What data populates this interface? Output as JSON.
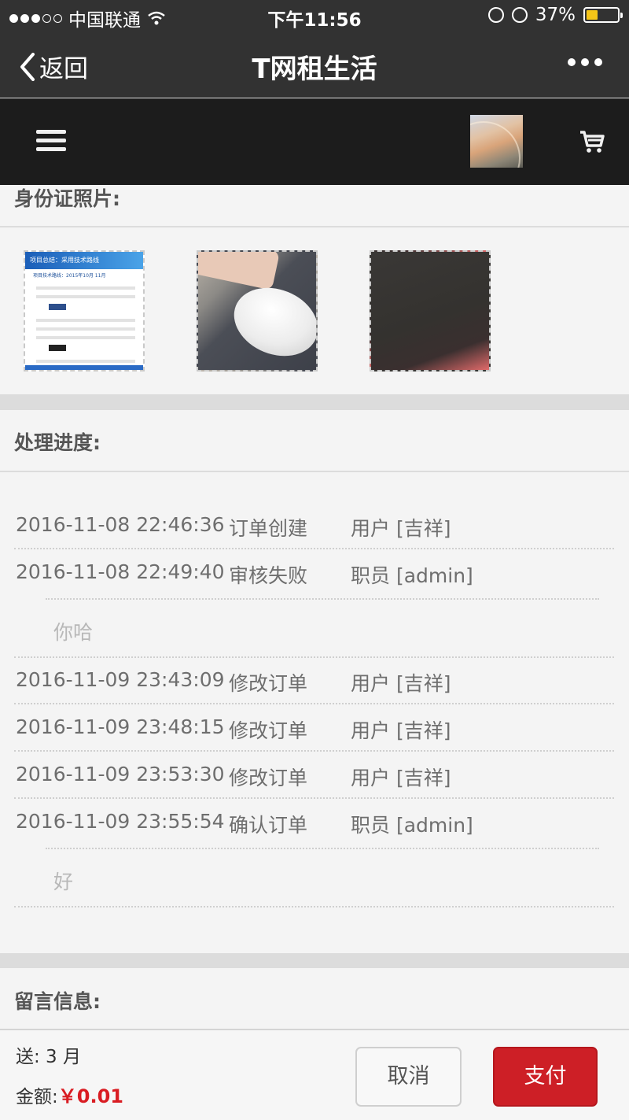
{
  "status_bar": {
    "carrier": "中国联通",
    "time": "下午11:56",
    "battery": "37%",
    "battery_level": 0.37,
    "signal_bars_filled": 3,
    "signal_bars_total": 5
  },
  "nav": {
    "back_label": "返回",
    "title": "T网租生活",
    "more_icon": "ellipsis-icon"
  },
  "header": {
    "menu_icon": "hamburger-icon",
    "cart_icon": "shopping-cart-icon"
  },
  "id_photos": {
    "title": "身份证照片:",
    "doc_thumb_heading": "项目总结：采用技术路线",
    "doc_thumb_sub": "项目技术路线：2015年10月 11月"
  },
  "progress": {
    "title": "处理进度:",
    "entries": [
      {
        "time": "2016-11-08 22:46:36",
        "action": "订单创建",
        "who": "用户 [吉祥]"
      },
      {
        "time": "2016-11-08 22:49:40",
        "action": "审核失败",
        "who": "职员 [admin]",
        "note": "你哈"
      },
      {
        "time": "2016-11-09 23:43:09",
        "action": "修改订单",
        "who": "用户 [吉祥]"
      },
      {
        "time": "2016-11-09 23:48:15",
        "action": "修改订单",
        "who": "用户 [吉祥]"
      },
      {
        "time": "2016-11-09 23:53:30",
        "action": "修改订单",
        "who": "用户 [吉祥]"
      },
      {
        "time": "2016-11-09 23:55:54",
        "action": "确认订单",
        "who": "职员 [admin]",
        "note": "好"
      }
    ]
  },
  "messages": {
    "title": "留言信息:"
  },
  "footer": {
    "send_text": "送: 3 月",
    "amount_label": "金额:",
    "amount_value": "￥0.01",
    "cancel_label": "取消",
    "pay_label": "支付",
    "accent_color": "#cd1f26"
  }
}
